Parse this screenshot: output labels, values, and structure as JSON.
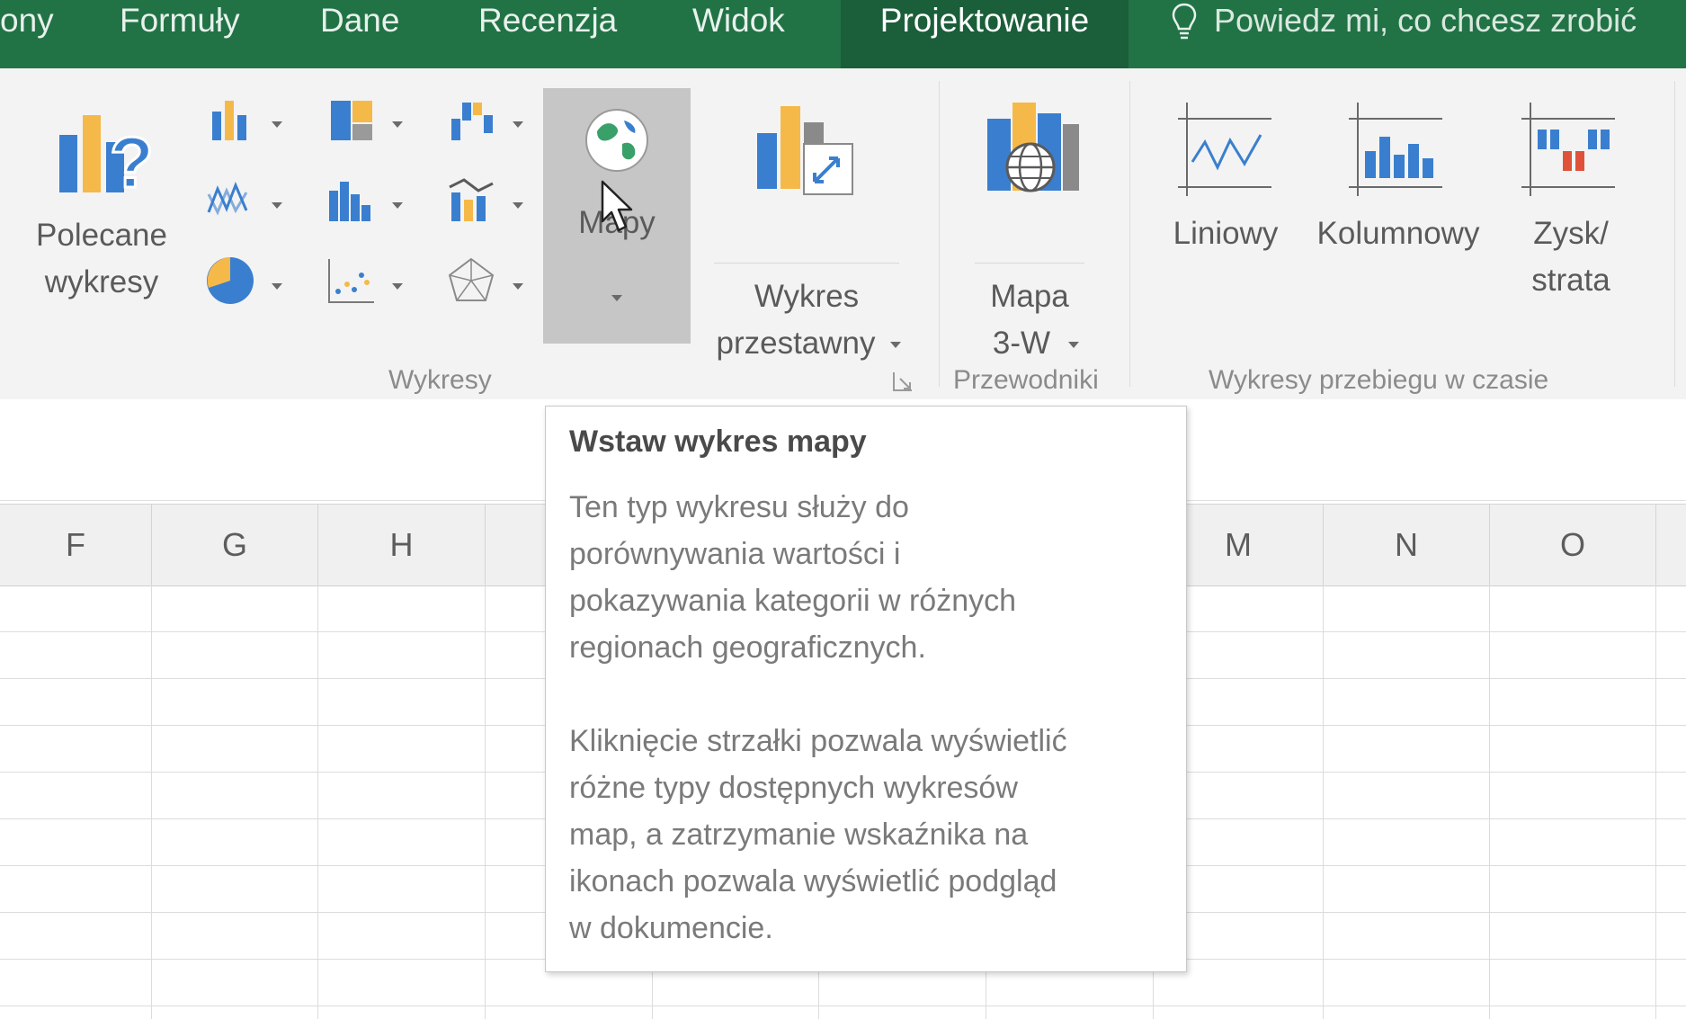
{
  "tabs": {
    "partial": "ony",
    "formulas": "Formuły",
    "data": "Dane",
    "review": "Recenzja",
    "view": "Widok",
    "design": "Projektowanie"
  },
  "tell_me": "Powiedz mi, co chcesz zrobić",
  "ribbon": {
    "recommended_line1": "Polecane",
    "recommended_line2": "wykresy",
    "maps_label": "Mapy",
    "pivot_line1": "Wykres",
    "pivot_line2": "przestawny",
    "map3d_line1": "Mapa",
    "map3d_line2": "3-W",
    "sparkline_line": "Liniowy",
    "sparkline_column": "Kolumnowy",
    "sparkline_winloss_line1": "Zysk/",
    "sparkline_winloss_line2": "strata",
    "group_charts": "Wykresy",
    "group_tours": "Przewodniki",
    "group_sparklines": "Wykresy przebiegu w czasie"
  },
  "columns": [
    "F",
    "G",
    "H",
    "",
    "",
    "",
    "",
    "M",
    "N",
    "O"
  ],
  "tooltip": {
    "title": "Wstaw wykres mapy",
    "p1_l1": "Ten typ wykresu służy do",
    "p1_l2": "porównywania wartości i",
    "p1_l3": "pokazywania kategorii w różnych",
    "p1_l4": "regionach geograficznych.",
    "p2_l1": "Kliknięcie strzałki pozwala wyświetlić",
    "p2_l2": "różne typy dostępnych wykresów",
    "p2_l3": "map, a zatrzymanie wskaźnika na",
    "p2_l4": "ikonach pozwala wyświetlić podgląd",
    "p2_l5": "w dokumencie."
  },
  "colors": {
    "tab_bar": "#217346",
    "active_tab": "#1b5e3a",
    "ribbon_bg": "#f3f3f3",
    "chart_blue": "#3a7fcf",
    "chart_orange": "#f5b94a",
    "chart_red": "#e0513a"
  }
}
